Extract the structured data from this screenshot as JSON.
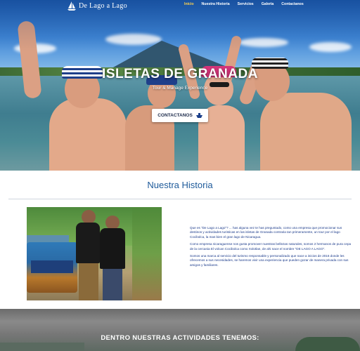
{
  "nav": {
    "brand": "De Lago a Lago",
    "items": [
      {
        "label": "Inicio",
        "active": true
      },
      {
        "label": "Nuestra Historia",
        "active": false
      },
      {
        "label": "Servicios",
        "active": false
      },
      {
        "label": "Galeria",
        "active": false
      },
      {
        "label": "Contactanos",
        "active": false
      }
    ]
  },
  "hero": {
    "title": "ISLETAS DE GRANADA",
    "subtitle": "Tour & Manage Experience",
    "cta_label": "CONTACTANOS",
    "cta_icon": "boat-icon"
  },
  "historia": {
    "title": "Nuestra Historia",
    "paragraphs": [
      "Que es \"De Lago a Lago\"? ... has alguna vez te has preguntado, como una empresa que promocionar sus destinos y actividades turisticas en las isletas de Granada contraria tan primeramente, un tour por el lago Cocibolca, la mas bien el gran lago de Nicaragua.",
      "Como empresa nicaraguense nos gusta promover nuestras bellezas naturales, somos 2 hermanos de pura cepa de la cercania El volcan Cocibolca como Xolotlan, de ahi nace el nombre \"DE LAGO A LAGO\".",
      "Somos una marca al servicio del turismo responsable y personalizado que nace a inicios de 2016 donde les ofrecemos a sus necesidades, se haremos vivir una experiencia que pueden gozar de manera privada con sus amigos y familiares."
    ]
  },
  "actividades": {
    "title": "DENTRO NUESTRAS ACTIVIDADES TENEMOS:"
  },
  "colors": {
    "accent_title": "#1e5a9a",
    "body_text": "#1a3a8a",
    "active_nav": "#ffd24d"
  }
}
